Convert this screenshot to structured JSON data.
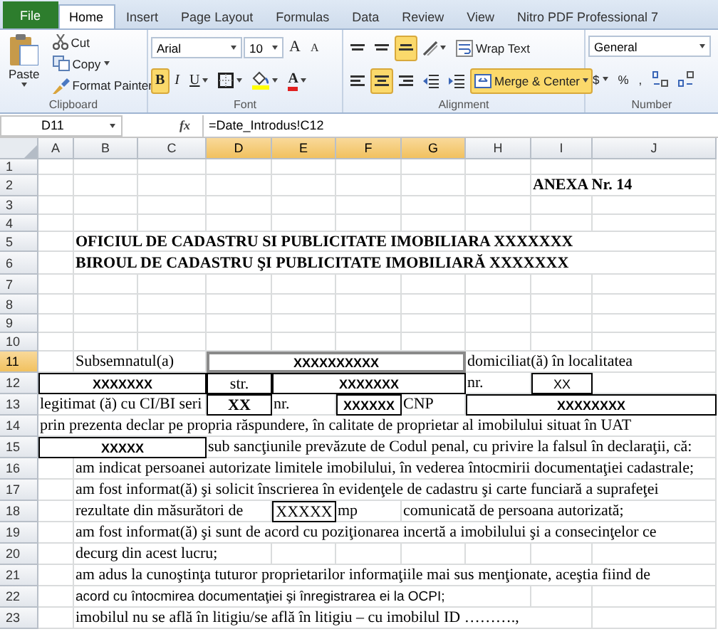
{
  "ribbon": {
    "tabs": [
      {
        "label": "File",
        "kind": "file",
        "selected": false
      },
      {
        "label": "Home",
        "kind": "tab",
        "selected": true
      },
      {
        "label": "Insert",
        "kind": "tab",
        "selected": false
      },
      {
        "label": "Page Layout",
        "kind": "tab",
        "selected": false
      },
      {
        "label": "Formulas",
        "kind": "tab",
        "selected": false
      },
      {
        "label": "Data",
        "kind": "tab",
        "selected": false
      },
      {
        "label": "Review",
        "kind": "tab",
        "selected": false
      },
      {
        "label": "View",
        "kind": "tab",
        "selected": false
      },
      {
        "label": "Nitro PDF Professional 7",
        "kind": "tab",
        "selected": false
      }
    ],
    "groups": [
      {
        "label": "Clipboard",
        "large": {
          "kind": "paste",
          "label": "Paste",
          "menu": true,
          "on": false
        },
        "toolbars": [
          {
            "items": [
              {
                "kind": "cut",
                "label": "Cut",
                "on": false
              }
            ]
          },
          {
            "items": [
              {
                "kind": "copy",
                "label": "Copy",
                "menu": true,
                "on": false
              }
            ]
          },
          {
            "items": [
              {
                "kind": "painter",
                "label": "Format Painter",
                "on": false
              }
            ]
          }
        ]
      },
      {
        "label": "Font",
        "toolbars": [
          {
            "items": [
              {
                "kind": "font-combo",
                "value": "Arial"
              },
              {
                "kind": "size-combo",
                "value": "10"
              },
              {
                "kind": "grow",
                "label": "A",
                "on": false
              },
              {
                "kind": "shrink",
                "label": "A",
                "on": false
              }
            ]
          },
          {
            "items": [
              {
                "kind": "bold",
                "label": "B",
                "on": true
              },
              {
                "kind": "italic",
                "label": "I",
                "on": false
              },
              {
                "kind": "underline",
                "label": "U",
                "menu": true,
                "on": false
              },
              {
                "kind": "border",
                "menu": true,
                "on": false
              },
              {
                "kind": "fill-color",
                "menu": true,
                "on": false
              },
              {
                "kind": "font-color",
                "label": "A",
                "menu": true,
                "on": false
              }
            ]
          }
        ]
      },
      {
        "label": "Alignment",
        "toolbars": [
          {
            "items": [
              {
                "kind": "align-top",
                "on": false
              },
              {
                "kind": "align-middle",
                "on": false
              },
              {
                "kind": "align-bottom",
                "on": true
              },
              {
                "kind": "orientation",
                "menu": true,
                "on": false
              },
              {
                "kind": "wrap",
                "label": "Wrap Text",
                "on": false
              }
            ]
          },
          {
            "items": [
              {
                "kind": "align-left",
                "on": false
              },
              {
                "kind": "align-center",
                "on": true
              },
              {
                "kind": "align-right",
                "on": false
              },
              {
                "kind": "indent-decrease",
                "on": false
              },
              {
                "kind": "indent-increase",
                "on": false
              },
              {
                "kind": "merge",
                "label": "Merge & Center",
                "menu": true,
                "on": true
              }
            ]
          }
        ]
      },
      {
        "label": "Number",
        "toolbars": [
          {
            "items": [
              {
                "kind": "format-combo",
                "value": "General"
              }
            ]
          },
          {
            "items": [
              {
                "kind": "symbol",
                "label": "$",
                "menu": true,
                "on": false
              },
              {
                "kind": "symbol",
                "label": "%",
                "on": false
              },
              {
                "kind": "symbol",
                "label": ",",
                "on": false
              },
              {
                "kind": "increase-decimal",
                "on": false
              },
              {
                "kind": "decrease-decimal",
                "on": false
              }
            ]
          }
        ]
      }
    ]
  },
  "formula_bar": {
    "name_box": "D11",
    "fx": "fx",
    "formula": "=Date_Introdus!C12"
  },
  "sheet": {
    "columns": [
      {
        "label": "A",
        "selected": false
      },
      {
        "label": "B",
        "selected": false
      },
      {
        "label": "C",
        "selected": false
      },
      {
        "label": "D",
        "selected": true
      },
      {
        "label": "E",
        "selected": true
      },
      {
        "label": "F",
        "selected": true
      },
      {
        "label": "G",
        "selected": true
      },
      {
        "label": "H",
        "selected": false
      },
      {
        "label": "I",
        "selected": false
      },
      {
        "label": "J",
        "selected": false
      }
    ],
    "rows": [
      {
        "label": "1",
        "selected": false
      },
      {
        "label": "2",
        "selected": false,
        "cells": [
          {
            "text": "ANEXA Nr. 14",
            "kind": "bold-text",
            "selected": false
          }
        ]
      },
      {
        "label": "3",
        "selected": false
      },
      {
        "label": "4",
        "selected": false
      },
      {
        "label": "5",
        "selected": false,
        "cells": [
          {
            "text": "OFICIUL DE CADASTRU SI PUBLICITATE IMOBILIARA XXXXXXX",
            "kind": "bold-text",
            "selected": false
          }
        ]
      },
      {
        "label": "6",
        "selected": false,
        "cells": [
          {
            "text": "BIROUL DE CADASTRU ŞI PUBLICITATE IMOBILIARĂ XXXXXXX",
            "kind": "bold-text",
            "selected": false
          }
        ]
      },
      {
        "label": "7",
        "selected": false
      },
      {
        "label": "8",
        "selected": false
      },
      {
        "label": "9",
        "selected": false
      },
      {
        "label": "10",
        "selected": false
      },
      {
        "label": "11",
        "selected": true,
        "cells": [
          {
            "text": "Subsemnatul(a)",
            "kind": "text",
            "selected": false
          },
          {
            "text": "XXXXXXXXXX",
            "kind": "field",
            "selected": true
          },
          {
            "text": "domiciliat(ă) în localitatea",
            "kind": "text",
            "selected": false
          }
        ]
      },
      {
        "label": "12",
        "selected": false,
        "cells": [
          {
            "text": "XXXXXXX",
            "kind": "field",
            "selected": false
          },
          {
            "text": "str.",
            "kind": "serif-field",
            "selected": false
          },
          {
            "text": "XXXXXXX",
            "kind": "field",
            "selected": false
          },
          {
            "text": "nr.",
            "kind": "text",
            "selected": false
          },
          {
            "text": "XX",
            "kind": "plain-field",
            "selected": false
          }
        ]
      },
      {
        "label": "13",
        "selected": false,
        "cells": [
          {
            "text": "legitimat (ă) cu CI/BI seri",
            "kind": "text",
            "selected": false
          },
          {
            "text": "XX",
            "kind": "bold-serif-field",
            "selected": false
          },
          {
            "text": "nr.",
            "kind": "text",
            "selected": false
          },
          {
            "text": "XXXXXX",
            "kind": "field",
            "selected": false
          },
          {
            "text": "CNP",
            "kind": "text",
            "selected": false
          },
          {
            "text": "XXXXXXXX",
            "kind": "field",
            "selected": false
          }
        ]
      },
      {
        "label": "14",
        "selected": false,
        "cells": [
          {
            "text": "prin prezenta declar pe propria răspundere, în calitate de proprietar al imobilului situat în UAT",
            "kind": "text",
            "selected": false
          }
        ]
      },
      {
        "label": "15",
        "selected": false,
        "cells": [
          {
            "text": "XXXXX",
            "kind": "field",
            "selected": false
          },
          {
            "text": "sub sancţiunile prevăzute de Codul penal, cu privire la falsul în declaraţii, că:",
            "kind": "text",
            "selected": false
          }
        ]
      },
      {
        "label": "16",
        "selected": false,
        "cells": [
          {
            "text": "am indicat persoanei autorizate limitele imobilului, în vederea întocmirii documentaţiei cadastrale;",
            "kind": "text",
            "selected": false
          }
        ]
      },
      {
        "label": "17",
        "selected": false,
        "cells": [
          {
            "text": "am fost informat(ă) şi solicit înscrierea în evidenţele de cadastru şi carte funciară a suprafeţei",
            "kind": "text",
            "selected": false
          }
        ]
      },
      {
        "label": "18",
        "selected": false,
        "cells": [
          {
            "text": "rezultate din măsurători de",
            "kind": "text",
            "selected": false
          },
          {
            "text": "XXXXX",
            "kind": "serif-field",
            "selected": false
          },
          {
            "text": "mp",
            "kind": "text",
            "selected": false
          },
          {
            "text": "comunicată de persoana autorizată;",
            "kind": "text",
            "selected": false
          }
        ]
      },
      {
        "label": "19",
        "selected": false,
        "cells": [
          {
            "text": "am fost informat(ă) şi sunt de acord cu poziţionarea incertă a imobilului şi a consecinţelor ce",
            "kind": "text",
            "selected": false
          }
        ]
      },
      {
        "label": "20",
        "selected": false,
        "cells": [
          {
            "text": "decurg din acest lucru;",
            "kind": "text",
            "selected": false
          }
        ]
      },
      {
        "label": "21",
        "selected": false,
        "cells": [
          {
            "text": "am adus la cunoştinţa tuturor proprietarilor informaţiile mai sus menţionate, aceştia fiind de",
            "kind": "text",
            "selected": false
          }
        ]
      },
      {
        "label": "22",
        "selected": false,
        "cells": [
          {
            "text": "acord cu întocmirea documentaţiei şi înregistrarea ei la OCPI;",
            "kind": "small-text",
            "selected": false
          }
        ]
      },
      {
        "label": "23",
        "selected": false,
        "cells": [
          {
            "text": "imobilul nu se află în litigiu/se află în litigiu – cu imobilul ID ……….,",
            "kind": "text",
            "selected": false
          }
        ]
      }
    ]
  }
}
